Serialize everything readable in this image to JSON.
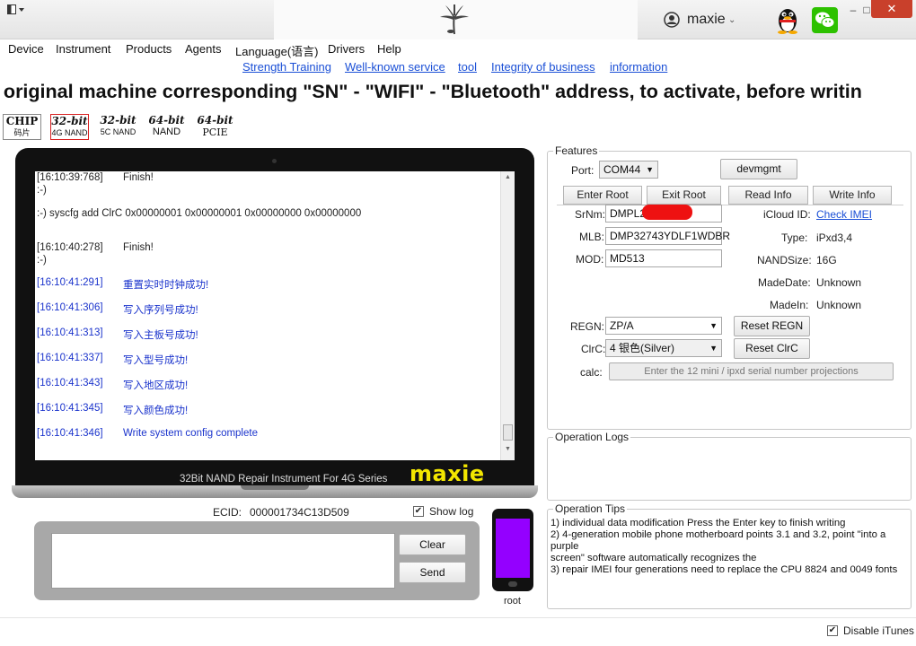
{
  "titlebar": {
    "user": "maxie",
    "minimize": "–",
    "maximize": "□",
    "close": "✕"
  },
  "menu": [
    "Device",
    "Instrument",
    "Products",
    "Agents",
    "Language(语言)",
    "Drivers",
    "Help"
  ],
  "links": [
    "Strength Training",
    "Well-known service",
    "tool",
    "Integrity of business",
    "information"
  ],
  "marquee": "e original machine corresponding \"SN\" - \"WIFI\" - \"Bluetooth\" address, to activate, before writin",
  "modes": [
    {
      "big": "CHIP",
      "small": "码片"
    },
    {
      "big": "32-bit",
      "small": "4G NAND"
    },
    {
      "big": "32-bit",
      "small": "5C NAND"
    },
    {
      "big": "64-bit",
      "small": "NAND"
    },
    {
      "big": "64-bit",
      "small": "PCIE"
    }
  ],
  "log": [
    {
      "ts": "[16:10:39:768]",
      "msg": "Finish!"
    },
    {
      "ts": ":-)",
      "msg": ""
    },
    {
      "ts": ":-) syscfg add ClrC 0x00000001 0x00000001 0x00000000 0x00000000",
      "msg": ""
    },
    {
      "ts": "[16:10:40:278]",
      "msg": "Finish!"
    },
    {
      "ts": ":-)",
      "msg": ""
    },
    {
      "ts": "[16:10:41:291]",
      "msg": "重置实时时钟成功!"
    },
    {
      "ts": "[16:10:41:306]",
      "msg": "写入序列号成功!"
    },
    {
      "ts": "[16:10:41:313]",
      "msg": "写入主板号成功!"
    },
    {
      "ts": "[16:10:41:337]",
      "msg": "写入型号成功!"
    },
    {
      "ts": "[16:10:41:343]",
      "msg": "写入地区成功!"
    },
    {
      "ts": "[16:10:41:345]",
      "msg": "写入颜色成功!"
    },
    {
      "ts": "[16:10:41:346]",
      "msg": "Write system config complete"
    }
  ],
  "laptop": {
    "caption": "32Bit NAND Repair Instrument For 4G Series",
    "brand": "maxie"
  },
  "ecid": {
    "label": "ECID:",
    "value": "000001734C13D509"
  },
  "show_log": {
    "label": "Show log",
    "checked": "✔"
  },
  "buttons": {
    "clear": "Clear",
    "send": "Send"
  },
  "phone": {
    "label": "root",
    "color": "#9400ff"
  },
  "features": {
    "title": "Features",
    "port_label": "Port:",
    "port_value": "COM44",
    "devmgmt": "devmgmt",
    "tabs": [
      "Enter Root",
      "Exit Root",
      "Read Info",
      "Write Info"
    ],
    "srnm_label": "SrNm:",
    "srnm_value": "DMPL2",
    "mlb_label": "MLB:",
    "mlb_value": "DMP32743YDLF1WDBR",
    "mod_label": "MOD:",
    "mod_value": "MD513",
    "icloud_label": "iCloud ID:",
    "icloud_value": "Check IMEI",
    "type_label": "Type:",
    "type_value": "iPxd3,4",
    "nandsize_label": "NANDSize:",
    "nandsize_value": "16G",
    "madedate_label": "MadeDate:",
    "madedate_value": "Unknown",
    "madein_label": "MadeIn:",
    "madein_value": "Unknown",
    "regn_label": "REGN:",
    "regn_value": "ZP/A",
    "reset_regn": "Reset REGN",
    "clrc_label": "ClrC:",
    "clrc_value": "4 银色(Silver)",
    "reset_clrc": "Reset ClrC",
    "calc_label": "calc:",
    "calc_placeholder": "Enter the 12 mini / ipxd serial number projections"
  },
  "operation_logs": {
    "title": "Operation Logs"
  },
  "operation_tips": {
    "title": "Operation Tips",
    "lines": [
      "1) individual data modification Press the Enter key to finish writing",
      "2) 4-generation mobile phone motherboard points 3.1 and 3.2, point \"into a purple",
      "screen\" software automatically recognizes the",
      "3) repair IMEI four generations need to replace the CPU 8824 and 0049 fonts"
    ]
  },
  "disable_itunes": {
    "label": "Disable iTunes",
    "checked": "✔"
  },
  "colors": {
    "link": "#1a4fd6",
    "close": "#c9402b",
    "brand_yellow": "#f3e600",
    "redact": "#ee1111"
  }
}
